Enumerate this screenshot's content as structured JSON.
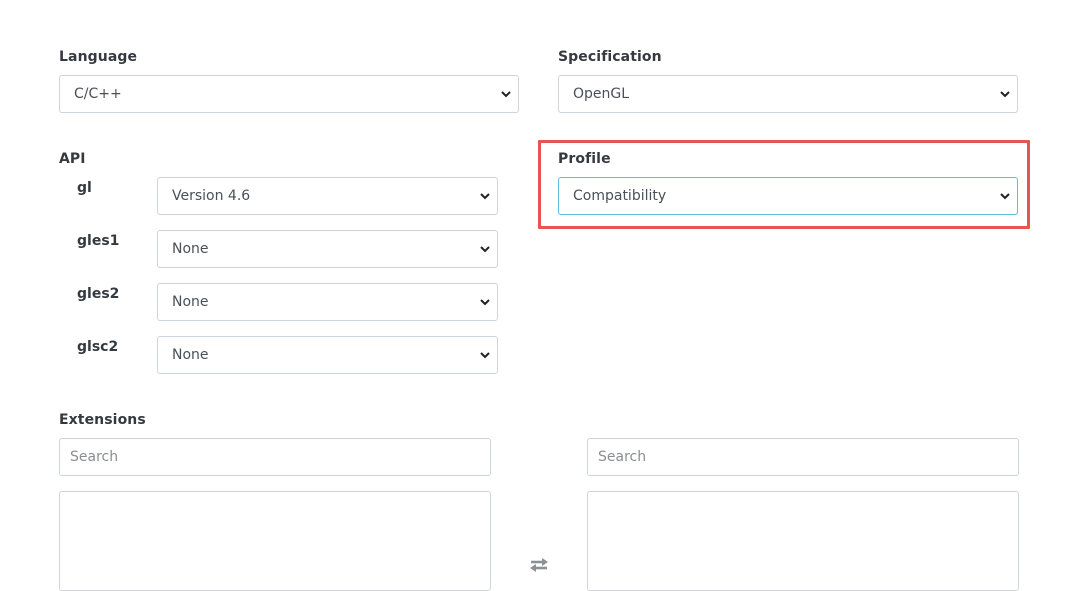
{
  "language": {
    "label": "Language",
    "selected": "C/C++"
  },
  "specification": {
    "label": "Specification",
    "selected": "OpenGL"
  },
  "api": {
    "label": "API",
    "rows": [
      {
        "name": "gl",
        "selected": "Version 4.6"
      },
      {
        "name": "gles1",
        "selected": "None"
      },
      {
        "name": "gles2",
        "selected": "None"
      },
      {
        "name": "glsc2",
        "selected": "None"
      }
    ]
  },
  "profile": {
    "label": "Profile",
    "selected": "Compatibility"
  },
  "extensions": {
    "label": "Extensions",
    "available_search_placeholder": "Search",
    "selected_search_placeholder": "Search",
    "swap_icon": "swap-arrows-icon"
  },
  "colors": {
    "highlight": "#e85454",
    "focus_border": "#5bc0de",
    "border": "#ced4da"
  }
}
